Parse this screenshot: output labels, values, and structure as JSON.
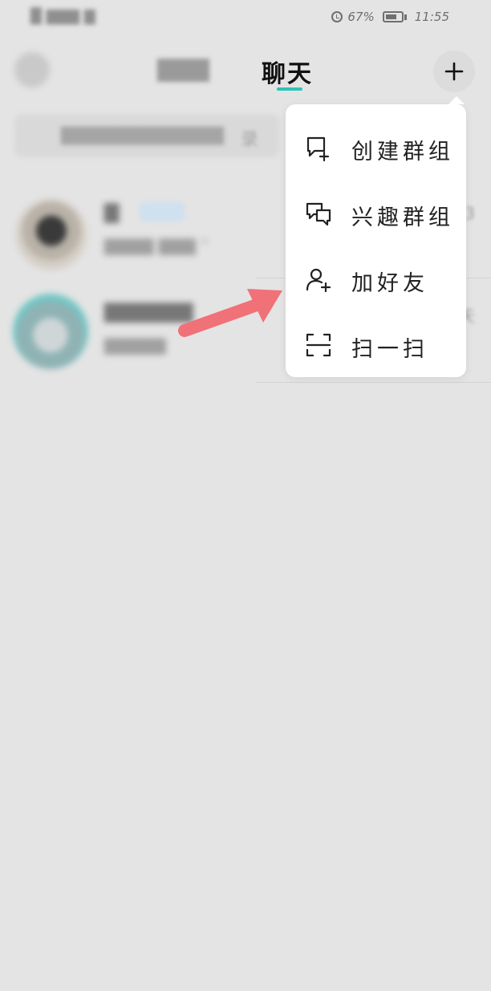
{
  "status_bar": {
    "left_text": "█ ▇▇▇ ▇",
    "battery_percent": "67%",
    "time": "11:55"
  },
  "header": {
    "tab_other": "▇▇▇",
    "tab_active": "聊天"
  },
  "search": {
    "placeholder": "▇▇▇▇▇▇▇▇▇▇▇▇",
    "tail": "录"
  },
  "chats": [
    {
      "name": "▇",
      "preview": "▇▇▇▇  ▇▇▇  ”",
      "time": "3"
    },
    {
      "name": "▇▇▇▇▇▇",
      "preview": "▇▇▇▇▇",
      "time": "天"
    }
  ],
  "menu": {
    "items": [
      {
        "label": "创建群组",
        "icon": "create-group-icon"
      },
      {
        "label": "兴趣群组",
        "icon": "interest-group-icon"
      },
      {
        "label": "加好友",
        "icon": "add-friend-icon"
      },
      {
        "label": "扫一扫",
        "icon": "scan-icon"
      }
    ]
  },
  "colors": {
    "accent": "#2ec4b6",
    "arrow": "#f07178",
    "overlay_bg": "#e4e4e4"
  }
}
